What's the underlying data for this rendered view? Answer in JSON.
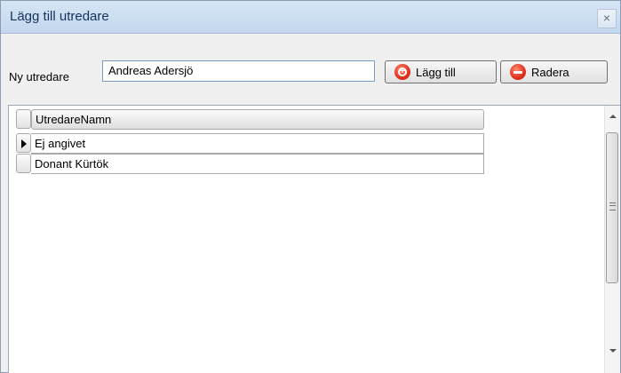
{
  "window": {
    "title": "Lägg till utredare",
    "close_symbol": "×"
  },
  "form": {
    "label": "Ny utredare",
    "input_value": "Andreas Adersjö",
    "add_label": "Lägg till",
    "add_icon": "plus-circle-icon",
    "delete_label": "Radera",
    "delete_icon": "minus-circle-icon",
    "icon_color": "#e0301b"
  },
  "grid": {
    "column_header": "UtredareNamn",
    "rows": [
      {
        "value": "Ej angivet",
        "current": true
      },
      {
        "value": "Donant Kürtök",
        "current": false
      }
    ]
  }
}
